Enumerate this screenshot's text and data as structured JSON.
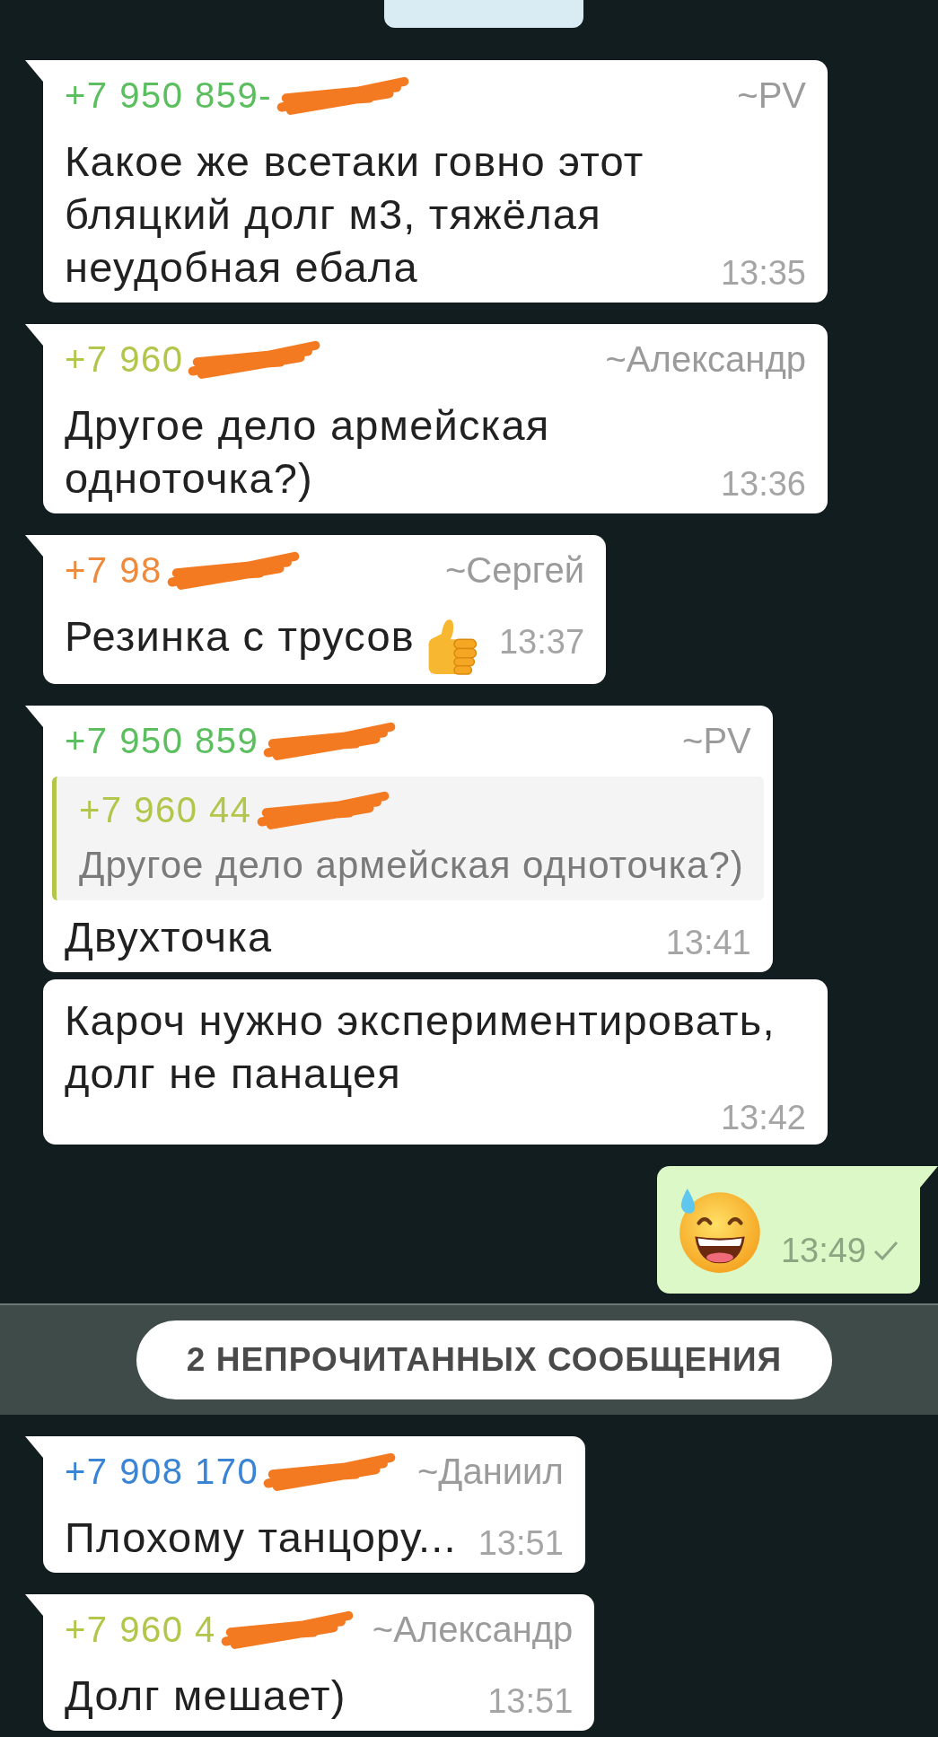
{
  "messages": [
    {
      "outgoing": false,
      "tail": true,
      "kind": "text",
      "sender": {
        "number": "+7 950 859-",
        "redacted": true,
        "name": "~PV",
        "color": "#5cbf5f"
      },
      "text": "Какое же всетаки говно этот бляцкий долг м3, тяжёлая неудобная ебала",
      "time": "13:35"
    },
    {
      "outgoing": false,
      "tail": true,
      "kind": "text",
      "sender": {
        "number": "+7 960",
        "redacted": true,
        "name": "~Александр",
        "color": "#b3c54a"
      },
      "text": "Другое дело армейская одноточка?)",
      "time": "13:36"
    },
    {
      "outgoing": false,
      "tail": true,
      "kind": "text_emoji",
      "sender": {
        "number": "+7 98",
        "redacted": true,
        "name": "~Сергей",
        "color": "#ef8a3d"
      },
      "text": "Резинка с трусов",
      "time": "13:37"
    },
    {
      "outgoing": false,
      "tail": true,
      "kind": "reply",
      "sender": {
        "number": "+7 950 859",
        "redacted": true,
        "name": "~PV",
        "color": "#5cbf5f"
      },
      "quote": {
        "number": "+7 960 44",
        "redacted": true,
        "color": "#b3c54a",
        "text": "Другое дело армейская одноточка?)"
      },
      "text": "Двухточка",
      "time": "13:41"
    },
    {
      "outgoing": false,
      "tail": false,
      "kind": "text",
      "text": "Кароч нужно экспериментировать, долг не панацея",
      "time": "13:42"
    },
    {
      "outgoing": true,
      "tail": true,
      "kind": "emoji",
      "time": "13:49",
      "sent": true
    }
  ],
  "unread_divider": {
    "label": "2 НЕПРОЧИТАННЫХ СООБЩЕНИЯ"
  },
  "new_messages": [
    {
      "outgoing": false,
      "tail": true,
      "kind": "text",
      "sender": {
        "number": "+7 908 170",
        "redacted": true,
        "name": "~Даниил",
        "color": "#3a84d6"
      },
      "text": "Плохому танцору...",
      "time": "13:51"
    },
    {
      "outgoing": false,
      "tail": true,
      "kind": "text",
      "sender": {
        "number": "+7 960 4",
        "redacted": true,
        "name": "~Александр",
        "color": "#b3c54a"
      },
      "text": "Долг мешает)",
      "time": "13:51"
    }
  ]
}
